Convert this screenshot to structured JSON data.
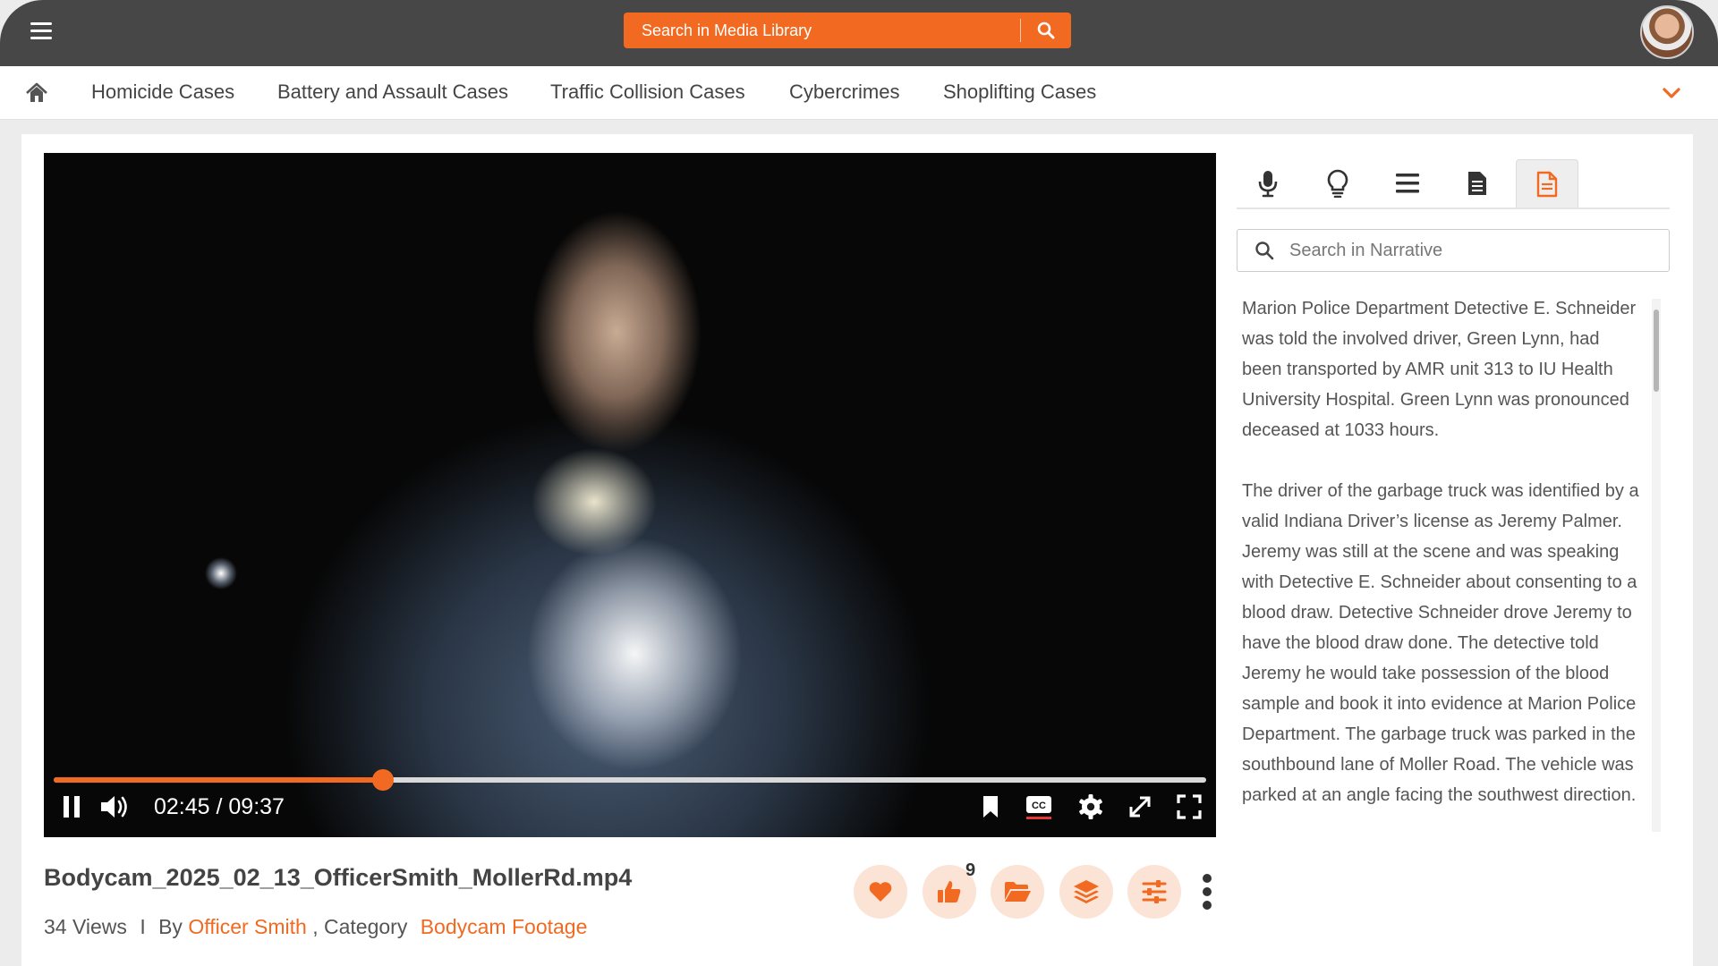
{
  "header": {
    "search_placeholder": "Search in Media Library",
    "icons": {
      "menu": "hamburger-icon",
      "search": "search-icon",
      "avatar": "user-avatar"
    },
    "accent_color": "#f26a21",
    "bar_color": "#474747"
  },
  "categories": {
    "items": [
      {
        "label": "Homicide Cases"
      },
      {
        "label": "Battery and Assault Cases"
      },
      {
        "label": "Traffic Collision Cases"
      },
      {
        "label": "Cybercrimes"
      },
      {
        "label": "Shoplifting Cases"
      }
    ],
    "icons": {
      "home": "home-icon",
      "more": "chevron-down-icon"
    }
  },
  "player": {
    "current_time": "02:45",
    "duration": "09:37",
    "time_display": "02:45 / 09:37",
    "progress_fraction": 0.286,
    "icons": [
      "pause-icon",
      "volume-icon",
      "bookmark-icon",
      "closed-captions-icon",
      "settings-gear-icon",
      "expand-icon",
      "fullscreen-icon"
    ]
  },
  "media": {
    "title": "Bodycam_2025_02_13_OfficerSmith_MollerRd.mp4",
    "views": "34 Views",
    "separator": "I",
    "by_label": "By",
    "author": "Officer Smith",
    "category_label": ", Category",
    "category": "Bodycam Footage",
    "likes": "9",
    "actions": [
      "heart-icon",
      "thumbs-up-icon",
      "folder-icon",
      "layers-icon",
      "sliders-icon",
      "more-vertical-icon"
    ]
  },
  "panel": {
    "tabs": [
      "microphone-icon",
      "lightbulb-icon",
      "list-icon",
      "document-icon",
      "narrative-document-icon"
    ],
    "active_tab": 4,
    "search_placeholder": "Search in Narrative",
    "paragraphs": [
      "Marion Police Department Detective E. Schneider was told the involved driver, Green Lynn, had been transported by AMR unit 313 to IU Health University Hospital. Green Lynn was pronounced deceased at 1033 hours.",
      "The driver of the garbage truck was identified by a valid Indiana Driver’s license as Jeremy Palmer. Jeremy was still at the scene and was speaking with Detective E. Schneider about consenting to a blood draw. Detective Schneider drove Jeremy to have the blood draw done. The detective told Jeremy he would take possession of the blood sample and book it into evidence at Marion Police Department. The garbage truck was parked in the southbound lane of Moller Road. The vehicle was parked at an angle facing the southwest direction."
    ]
  }
}
